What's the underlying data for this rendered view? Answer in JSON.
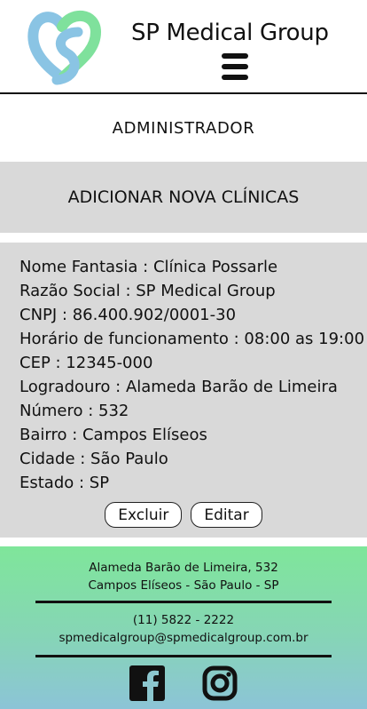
{
  "header": {
    "brand_name": "SP Medical Group",
    "logo_icon": "heart-s-logo-icon",
    "menu_icon": "hamburger-menu-icon"
  },
  "role_title": "ADMINISTRADOR",
  "add_clinic_label": "ADICIONAR NOVA CLÍNICAS",
  "clinic": {
    "fields": [
      "Nome Fantasia : Clínica Possarle",
      "Razão Social : SP Medical Group",
      "CNPJ : 86.400.902/0001-30",
      "Horário de funcionamento : 08:00 as 19:00",
      "CEP : 12345-000",
      "Logradouro : Alameda Barão de Limeira",
      "Número : 532",
      "Bairro : Campos Elíseos",
      "Cidade : São Paulo",
      "Estado : SP"
    ],
    "delete_label": "Excluir",
    "edit_label": "Editar"
  },
  "footer": {
    "address_line1": "Alameda Barão de Limeira, 532",
    "address_line2": "Campos Elíseos - São Paulo - SP",
    "phone": "(11) 5822 - 2222",
    "email": "spmedicalgroup@spmedicalgroup.com.br",
    "social_icons": [
      "facebook-icon",
      "instagram-icon"
    ]
  },
  "colors": {
    "logo_blue": "#8ac4e4",
    "logo_green": "#7fe19c",
    "panel_gray": "#d9d9d9"
  }
}
